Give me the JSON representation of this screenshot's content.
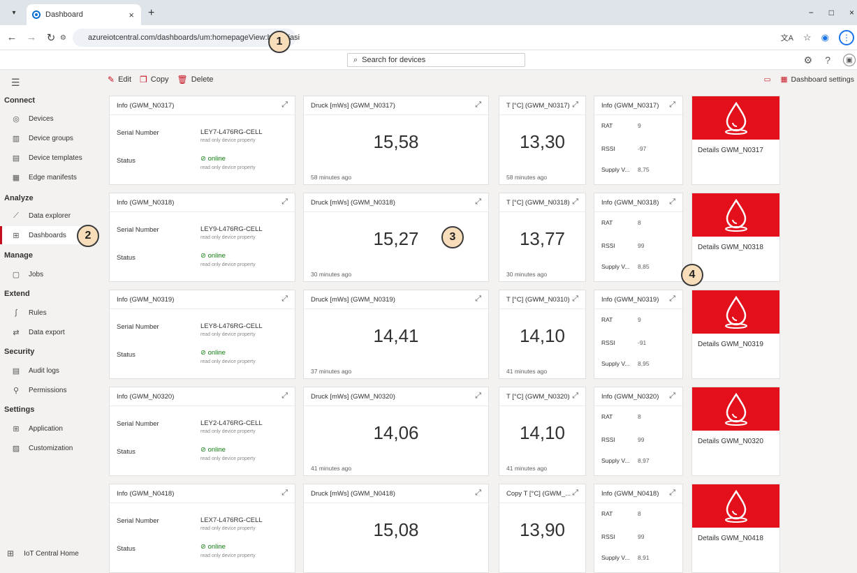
{
  "browser": {
    "tab_title": "Dashboard",
    "new_tab": "+",
    "tab_close": "×",
    "url": "azureiotcentral.com/dashboards/um:homepageView:hunbyiasi",
    "window_controls": [
      "−",
      "□",
      "×"
    ]
  },
  "callouts": [
    "1",
    "2",
    "3",
    "4"
  ],
  "header": {
    "search_placeholder": "Search for devices"
  },
  "sidebar": {
    "sections": [
      {
        "label": "Connect"
      },
      {
        "label": "Analyze"
      },
      {
        "label": "Manage"
      },
      {
        "label": "Extend"
      },
      {
        "label": "Security"
      },
      {
        "label": "Settings"
      }
    ],
    "items": [
      {
        "label": "Devices",
        "icon": "devices-icon"
      },
      {
        "label": "Device groups",
        "icon": "device-groups-icon"
      },
      {
        "label": "Device templates",
        "icon": "device-templates-icon"
      },
      {
        "label": "Edge manifests",
        "icon": "edge-manifests-icon"
      },
      {
        "label": "Data explorer",
        "icon": "data-explorer-icon"
      },
      {
        "label": "Dashboards",
        "icon": "dashboards-icon",
        "active": true
      },
      {
        "label": "Jobs",
        "icon": "jobs-icon"
      },
      {
        "label": "Rules",
        "icon": "rules-icon"
      },
      {
        "label": "Data export",
        "icon": "data-export-icon"
      },
      {
        "label": "Audit logs",
        "icon": "audit-logs-icon"
      },
      {
        "label": "Permissions",
        "icon": "permissions-icon"
      },
      {
        "label": "Application",
        "icon": "application-icon"
      },
      {
        "label": "Customization",
        "icon": "customization-icon"
      }
    ],
    "home_label": "IoT Central Home"
  },
  "toolbar": {
    "edit": "Edit",
    "copy": "Copy",
    "delete": "Delete",
    "dashboard_settings": "Dashboard settings"
  },
  "labels": {
    "serial_number": "Serial Number",
    "status": "Status",
    "read_only": "read only device property",
    "rat": "RAT",
    "rssi": "RSSI",
    "supply": "Supply V..."
  },
  "rows": [
    {
      "info_title": "Info (GWM_N0317)",
      "serial": "LEY7-L476RG-CELL",
      "status": "online",
      "druck_title": "Druck [mWs] (GWM_N0317)",
      "druck_value": "15,58",
      "druck_ago": "58 minutes ago",
      "temp_title": "T [°C] (GWM_N0317)",
      "temp_value": "13,30",
      "temp_ago": "58 minutes ago",
      "small_title": "Info (GWM_N0317)",
      "rat": "9",
      "rssi": "-97",
      "supply": "8,75",
      "details": "Details GWM_N0317"
    },
    {
      "info_title": "Info (GWM_N0318)",
      "serial": "LEY9-L476RG-CELL",
      "status": "online",
      "druck_title": "Druck [mWs] (GWM_N0318)",
      "druck_value": "15,27",
      "druck_ago": "30 minutes ago",
      "temp_title": "T [°C] (GWM_N0318)",
      "temp_value": "13,77",
      "temp_ago": "30 minutes ago",
      "small_title": "Info (GWM_N0318)",
      "rat": "8",
      "rssi": "99",
      "supply": "8,85",
      "details": "Details GWM_N0318"
    },
    {
      "info_title": "Info (GWM_N0319)",
      "serial": "LEY8-L476RG-CELL",
      "status": "online",
      "druck_title": "Druck [mWs] (GWM_N0319)",
      "druck_value": "14,41",
      "druck_ago": "37 minutes ago",
      "temp_title": "T [°C] (GWM_N0310)",
      "temp_value": "14,10",
      "temp_ago": "41 minutes ago",
      "small_title": "Info (GWM_N0319)",
      "rat": "9",
      "rssi": "-91",
      "supply": "8,95",
      "details": "Details GWM_N0319"
    },
    {
      "info_title": "Info (GWM_N0320)",
      "serial": "LEY2-L476RG-CELL",
      "status": "online",
      "druck_title": "Druck [mWs] (GWM_N0320)",
      "druck_value": "14,06",
      "druck_ago": "41 minutes ago",
      "temp_title": "T [°C] (GWM_N0320)",
      "temp_value": "14,10",
      "temp_ago": "41 minutes ago",
      "small_title": "Info (GWM_N0320)",
      "rat": "8",
      "rssi": "99",
      "supply": "8,97",
      "details": "Details GWM_N0320"
    },
    {
      "info_title": "Info (GWM_N0418)",
      "serial": "LEX7-L476RG-CELL",
      "status": "online",
      "druck_title": "Druck [mWs] (GWM_N0418)",
      "druck_value": "15,08",
      "druck_ago": "",
      "temp_title": "Copy T [°C] (GWM_...",
      "temp_value": "13,90",
      "temp_ago": "",
      "small_title": "Info (GWM_N0418)",
      "rat": "8",
      "rssi": "99",
      "supply": "8,91",
      "details": "Details GWM_N0418"
    }
  ],
  "colors": {
    "accent": "#c50f1f",
    "tile_red": "#e3101b",
    "online": "#107c10"
  }
}
